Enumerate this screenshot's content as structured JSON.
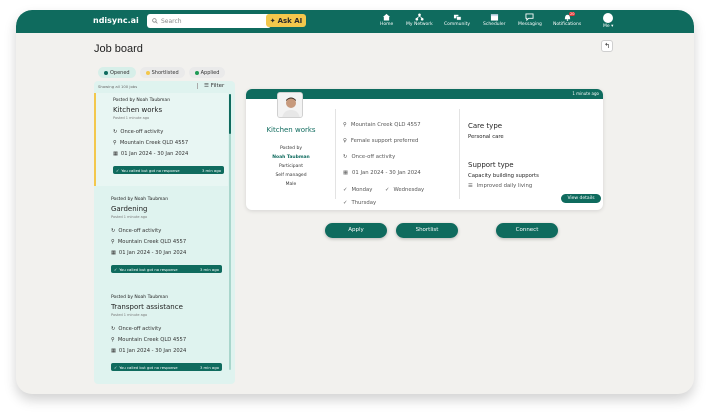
{
  "app": {
    "logo": "ndisync.ai"
  },
  "header": {
    "search_placeholder": "Search",
    "ask_ai_label": "Ask AI",
    "nav": [
      {
        "label": "Home",
        "icon": "home-icon"
      },
      {
        "label": "My Network",
        "icon": "network-icon"
      },
      {
        "label": "Community",
        "icon": "community-icon"
      },
      {
        "label": "Scheduler",
        "icon": "calendar-icon"
      },
      {
        "label": "Messaging",
        "icon": "message-icon"
      },
      {
        "label": "Notifications",
        "icon": "bell-icon",
        "badge": "20"
      },
      {
        "label": "Me",
        "icon": "avatar-icon"
      }
    ]
  },
  "page": {
    "title": "Job board",
    "tabs": [
      {
        "label": "Opened",
        "color": "#0f6b5e",
        "active": true
      },
      {
        "label": "Shortlisted",
        "color": "#f3c74c",
        "active": false
      },
      {
        "label": "Applied",
        "color": "#1f9b55",
        "active": false
      }
    ],
    "list_summary": "Showing all 100 jobs",
    "filter_label": "Filter"
  },
  "jobs": [
    {
      "posted_by": "Posted by Noah Taubman",
      "title": "Kitchen works",
      "ago": "Posted 1 minute ago",
      "activity": "Once-off activity",
      "location": "Mountain Creek QLD 4557",
      "dates": "01 Jan 2024  -  30 Jan 2024",
      "status": "You called but got no response",
      "status_time": "3 min ago"
    },
    {
      "posted_by": "Posted by Noah Taubman",
      "title": "Gardening",
      "ago": "Posted 1 minute ago",
      "activity": "Once-off activity",
      "location": "Mountain Creek QLD 4557",
      "dates": "01 Jan 2024  -  30 Jan 2024",
      "status": "You called but got no response",
      "status_time": "3 min ago"
    },
    {
      "posted_by": "Posted by Noah Taubman",
      "title": "Transport assistance",
      "ago": "Posted 1 minute ago",
      "activity": "Once-off activity",
      "location": "Mountain Creek QLD 4557",
      "dates": "01 Jan 2024  -  30 Jan 2024",
      "status": "You called but got no response",
      "status_time": "3 min ago"
    }
  ],
  "detail": {
    "ago": "1 minute ago",
    "title": "Kitchen works",
    "posted_by_label": "Posted by",
    "poster": "Noah Taubman",
    "role": "Participant",
    "management": "Self managed",
    "gender": "Male",
    "location": "Mountain Creek QLD 4557",
    "preference": "Female support preferred",
    "activity": "Once-off activity",
    "dates": "01 Jan 2024  -  30 Jan 2024",
    "days": [
      "Monday",
      "Wednesday",
      "Thursday"
    ],
    "care_type_label": "Care type",
    "care_type": "Personal care",
    "support_type_label": "Support type",
    "support_type": "Capacity building supports",
    "support_sub": "Improved daily living",
    "view_details": "View details"
  },
  "actions": {
    "apply": "Apply",
    "shortlist": "Shortlist",
    "connect": "Connect"
  },
  "colors": {
    "primary": "#0f6b5e",
    "accent": "#f3c74c",
    "panel": "#dff3ef"
  }
}
